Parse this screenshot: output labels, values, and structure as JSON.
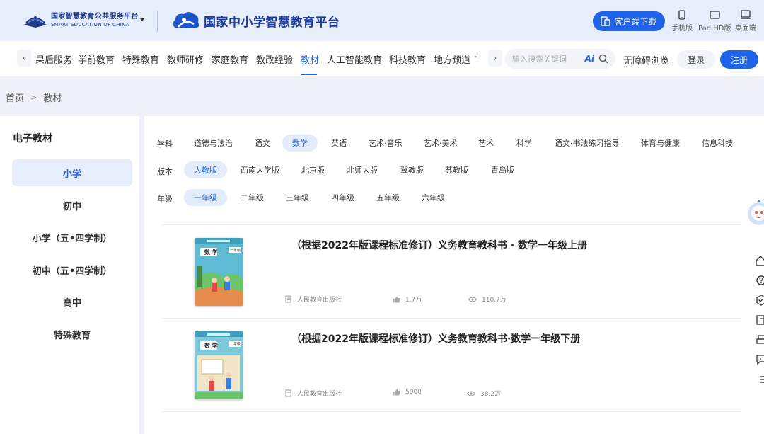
{
  "header": {
    "logo_cn": "国家智慧教育公共服务平台",
    "logo_en": "SMART EDUCATION OF CHINA",
    "platform_name": "国家中小学智慧教育平台",
    "download_label": "客户端下载",
    "devices": [
      {
        "label": "手机版",
        "icon": "phone-icon"
      },
      {
        "label": "Pad HD版",
        "icon": "tablet-icon"
      },
      {
        "label": "桌面端",
        "icon": "desktop-icon"
      }
    ]
  },
  "nav": {
    "items": [
      "果后服务",
      "学前教育",
      "特殊教育",
      "教师研修",
      "家庭教育",
      "教改经验",
      "教材",
      "人工智能教育",
      "科技教育",
      "地方频道"
    ],
    "active": "教材",
    "search_placeholder": "输入搜索关键词",
    "ai_label": "Ai",
    "accessibility": "无障碍浏览",
    "login": "登录",
    "register": "注册"
  },
  "breadcrumb": {
    "home": "首页",
    "current": "教材"
  },
  "sidebar": {
    "title": "电子教材",
    "items": [
      "小学",
      "初中",
      "小学（五•四学制）",
      "初中（五•四学制）",
      "高中",
      "特殊教育"
    ],
    "active": "小学"
  },
  "filters": {
    "subject": {
      "label": "学科",
      "options": [
        "道德与法治",
        "语文",
        "数学",
        "英语",
        "艺术·音乐",
        "艺术·美术",
        "艺术",
        "科学",
        "语文·书法练习指导",
        "体育与健康",
        "信息科技"
      ],
      "active": "数学"
    },
    "edition": {
      "label": "版本",
      "options": [
        "人教版",
        "西南大学版",
        "北京版",
        "北师大版",
        "冀教版",
        "苏教版",
        "青岛版"
      ],
      "active": "人教版"
    },
    "grade": {
      "label": "年级",
      "options": [
        "一年级",
        "二年级",
        "三年级",
        "四年级",
        "五年级",
        "六年级"
      ],
      "active": "一年级"
    }
  },
  "books": [
    {
      "title": "（根据2022年版课程标准修订）义务教育教科书 · 数学一年级上册",
      "cover_label": "数 学",
      "grade_tag": "一年级",
      "publisher": "人民教育出版社",
      "likes": "1.7万",
      "views": "110.7万"
    },
    {
      "title": "（根据2022年版课程标准修订）义务教育教科书·数学一年级下册",
      "cover_label": "数 学",
      "grade_tag": "一年级",
      "publisher": "人民教育出版社",
      "likes": "5000",
      "views": "38.2万"
    }
  ],
  "colors": {
    "primary": "#1f63e8",
    "header_bg": "#e6eefb",
    "page_bg": "#eef2f8"
  }
}
